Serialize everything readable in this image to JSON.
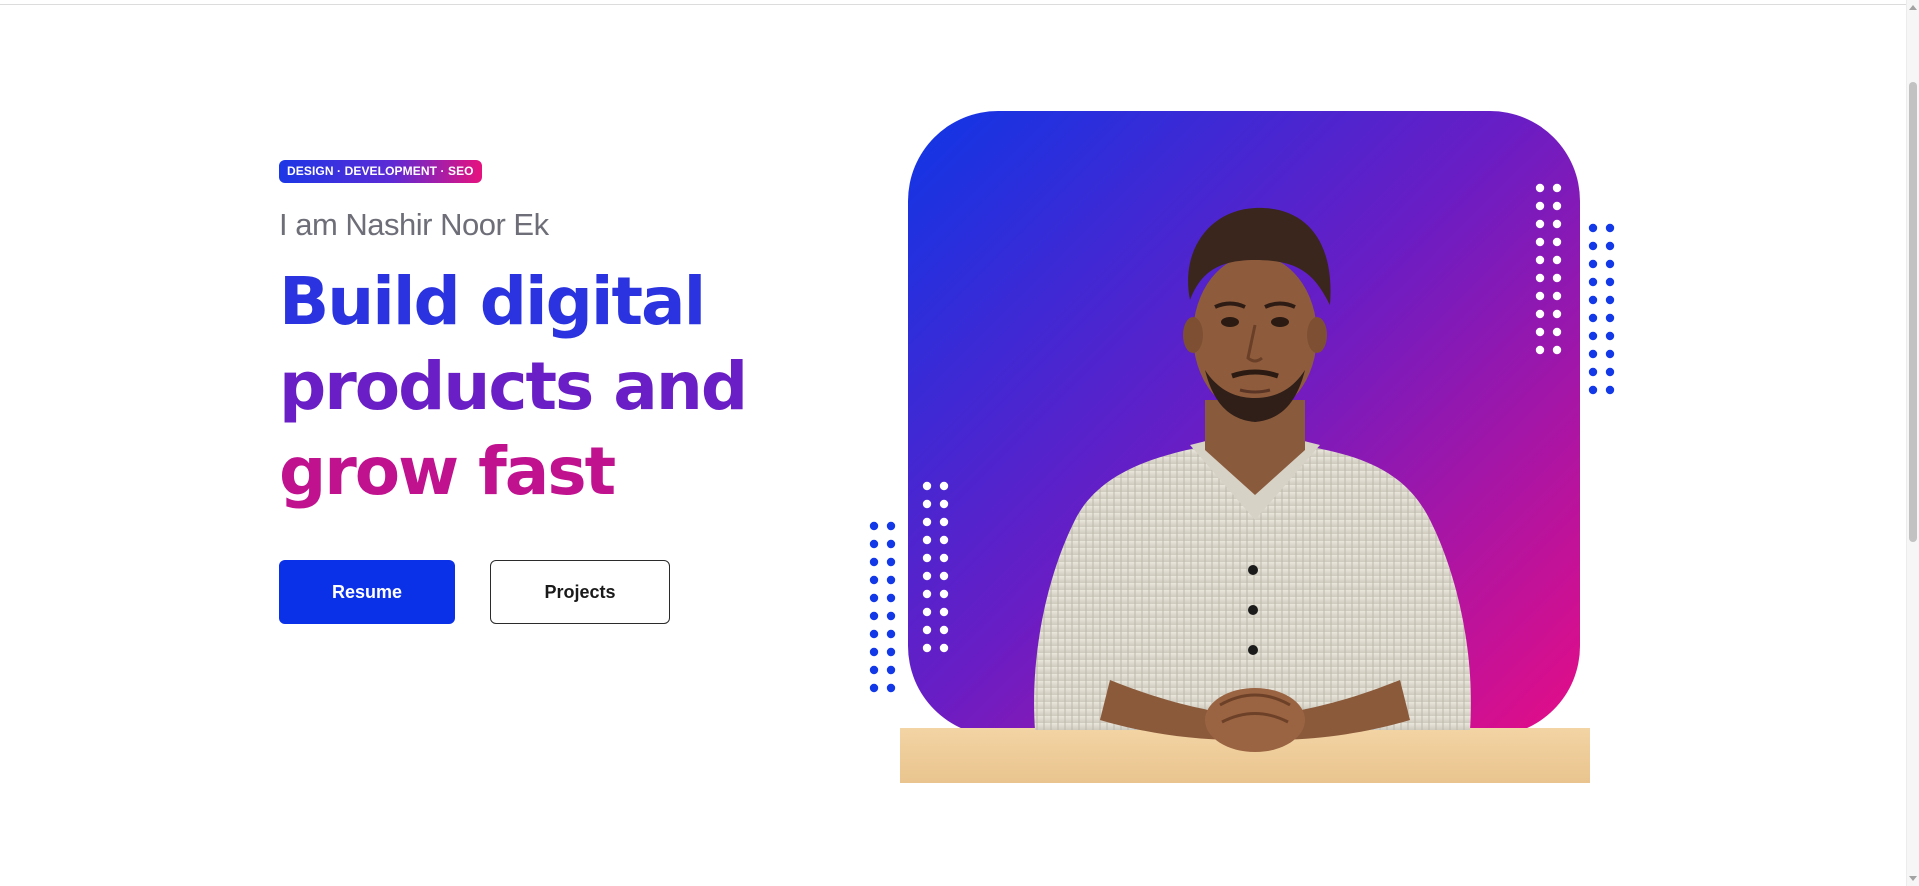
{
  "hero": {
    "badge": "DESIGN · DEVELOPMENT · SEO",
    "intro": "I am Nashir Noor Ek",
    "headline": {
      "line1": "Build digital",
      "line2": "products and",
      "line3": "grow fast"
    },
    "buttons": {
      "resume": "Resume",
      "projects": "Projects"
    }
  },
  "colors": {
    "primary_blue": "#0a30e8",
    "purple": "#6a1fc6",
    "magenta": "#e60d86",
    "dot_blue": "#1238e8",
    "dot_white": "#ffffff"
  },
  "visual": {
    "photo": "portrait-photo",
    "decorations": [
      "dot-grid-white-top-right",
      "dot-grid-blue-top-right",
      "dot-grid-white-bottom-left",
      "dot-grid-blue-bottom-left"
    ]
  }
}
